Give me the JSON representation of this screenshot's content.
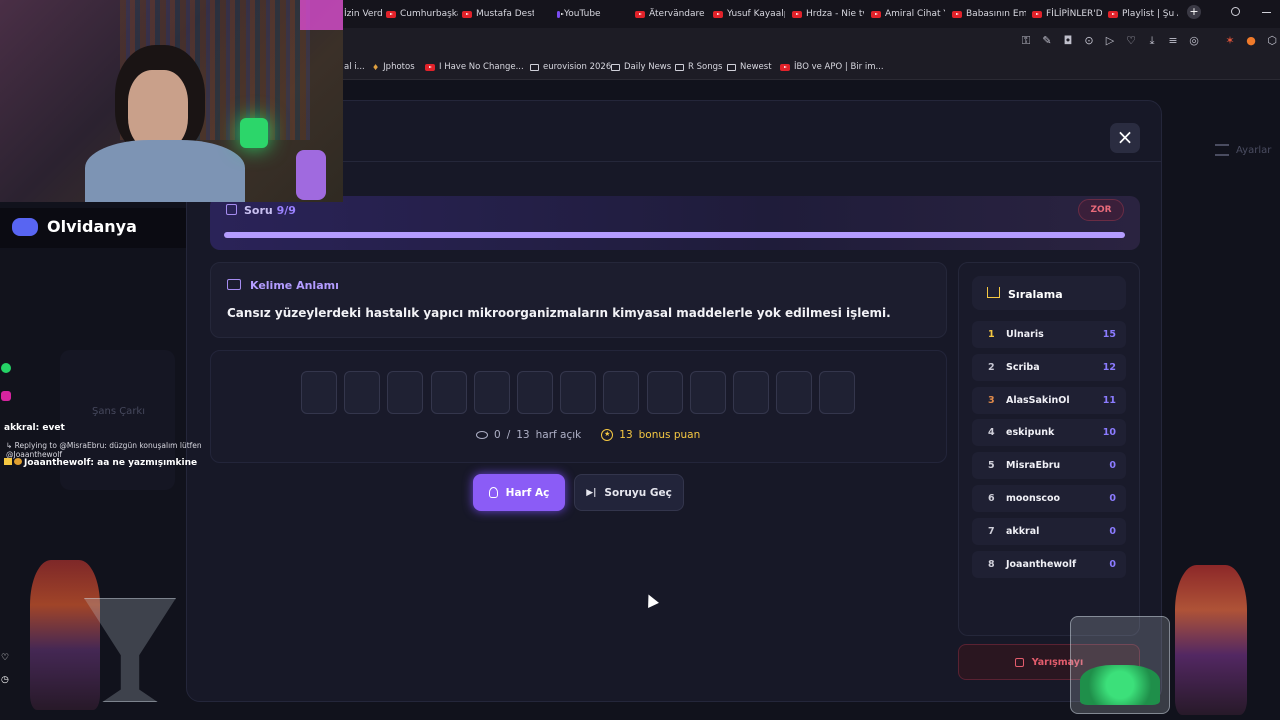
{
  "browser": {
    "tabs": [
      "İzin Verd",
      "Cumhurbaşkan",
      "Mustafa Destic",
      "YouTube",
      "Ätervändare - Y",
      "Yusuf Kayaalp:",
      "Hrdza - Nie tvo",
      "Amiral Cihat Ya",
      "Babasının Eman",
      "FİLİPİNLER'DE Y",
      "Playlist | Şu An"
    ],
    "bookmarks": [
      "al i...",
      "Jphotos",
      "I Have No Change...",
      "eurovision 2026",
      "Daily News",
      "R Songs",
      "Newest",
      "İBO ve APO | Bir im..."
    ],
    "new_tab": "+"
  },
  "overlay": {
    "discord_name": "Olvidanya",
    "chat": [
      {
        "user": "akkral:",
        "text": "evet"
      },
      {
        "user": "",
        "text": "Replying to @MisraEbru: düzgün konuşalım lütfen @Joaanthewolf"
      },
      {
        "user": "Joaanthewolf:",
        "text": "aa ne yazmışımkine"
      }
    ]
  },
  "background": {
    "settings_label": "Ayarlar",
    "card_title": "Şans Çarkı"
  },
  "modal": {
    "close": "×",
    "question_label": "Soru",
    "question_current": "9",
    "question_total": "/9",
    "progress": 1.0,
    "difficulty": "ZOR",
    "meaning_title": "Kelime Anlamı",
    "meaning_text": "Cansız yüzeylerdeki hastalık yapıcı mikroorganizmaların kimyasal maddelerle yok edilmesi işlemi.",
    "letter_count": 13,
    "opened": "0",
    "sep": "/",
    "total": "13",
    "opened_label": "harf açık",
    "bonus": "13",
    "bonus_label": "bonus puan",
    "btn_reveal": "Harf Aç",
    "btn_skip": "Soruyu Geç",
    "quit_label": "Yarışmayı"
  },
  "leaderboard": {
    "title": "Sıralama",
    "rows": [
      {
        "rank": "1",
        "name": "Ulnaris",
        "score": "15"
      },
      {
        "rank": "2",
        "name": "Scriba",
        "score": "12"
      },
      {
        "rank": "3",
        "name": "AlasSakinOl",
        "score": "11"
      },
      {
        "rank": "4",
        "name": "eskipunk",
        "score": "10"
      },
      {
        "rank": "5",
        "name": "MisraEbru",
        "score": "0"
      },
      {
        "rank": "6",
        "name": "moonscoo",
        "score": "0"
      },
      {
        "rank": "7",
        "name": "akkral",
        "score": "0"
      },
      {
        "rank": "8",
        "name": "Joaanthewolf",
        "score": "0"
      }
    ]
  },
  "colors": {
    "accent": "#8b5cf6",
    "gold": "#f5c842",
    "danger": "#e25c6c"
  }
}
